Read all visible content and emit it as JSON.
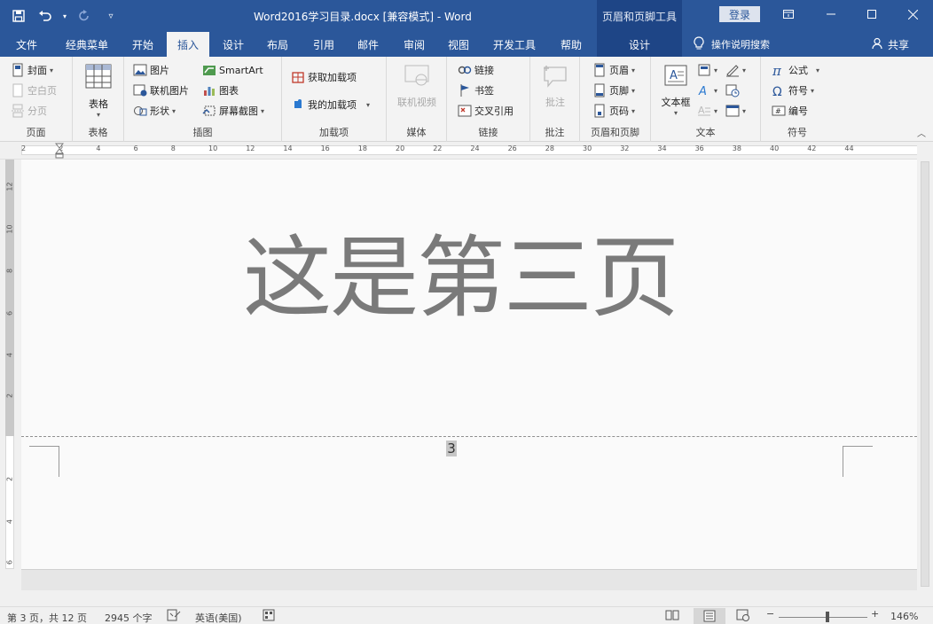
{
  "titlebar": {
    "doc_title": "Word2016学习目录.docx [兼容模式]  -  Word",
    "context_tool": "页眉和页脚工具",
    "login": "登录"
  },
  "tabs": [
    "文件",
    "经典菜单",
    "开始",
    "插入",
    "设计",
    "布局",
    "引用",
    "邮件",
    "审阅",
    "视图",
    "开发工具",
    "帮助",
    "设计"
  ],
  "active_tab": "插入",
  "tellme": "操作说明搜索",
  "share": "共享",
  "ribbon": {
    "pages": {
      "label": "页面",
      "cover": "封面",
      "blank": "空白页",
      "break": "分页"
    },
    "tables": {
      "label": "表格",
      "table": "表格"
    },
    "illustrations": {
      "label": "插图",
      "pictures": "图片",
      "online_pictures": "联机图片",
      "shapes": "形状",
      "smartart": "SmartArt",
      "chart": "图表",
      "screenshot": "屏幕截图"
    },
    "addins": {
      "label": "加载项",
      "get": "获取加载项",
      "my": "我的加载项"
    },
    "media": {
      "label": "媒体",
      "online_video": "联机视频"
    },
    "links": {
      "label": "链接",
      "link": "链接",
      "bookmark": "书签",
      "cross_ref": "交叉引用"
    },
    "comments": {
      "label": "批注",
      "comment": "批注"
    },
    "header_footer": {
      "label": "页眉和页脚",
      "header": "页眉",
      "footer": "页脚",
      "page_number": "页码"
    },
    "text": {
      "label": "文本",
      "textbox": "文本框"
    },
    "symbols": {
      "label": "符号",
      "equation": "公式",
      "symbol": "符号",
      "number": "编号"
    }
  },
  "ruler": {
    "h_ticks": [
      "2",
      "2",
      "4",
      "6",
      "8",
      "10",
      "12",
      "14",
      "16",
      "18",
      "20",
      "22",
      "24",
      "26",
      "28",
      "30",
      "32",
      "34",
      "36",
      "38",
      "40",
      "42",
      "44"
    ],
    "v_ticks": [
      "12",
      "10",
      "8",
      "6",
      "4",
      "2",
      "2",
      "4",
      "6"
    ]
  },
  "document": {
    "heading": "这是第三页",
    "page_number": "3"
  },
  "status": {
    "page": "第 3 页，共 12 页",
    "words": "2945 个字",
    "language": "英语(美国)",
    "zoom": "146%",
    "zoom_minus": "−",
    "zoom_plus": "+"
  }
}
